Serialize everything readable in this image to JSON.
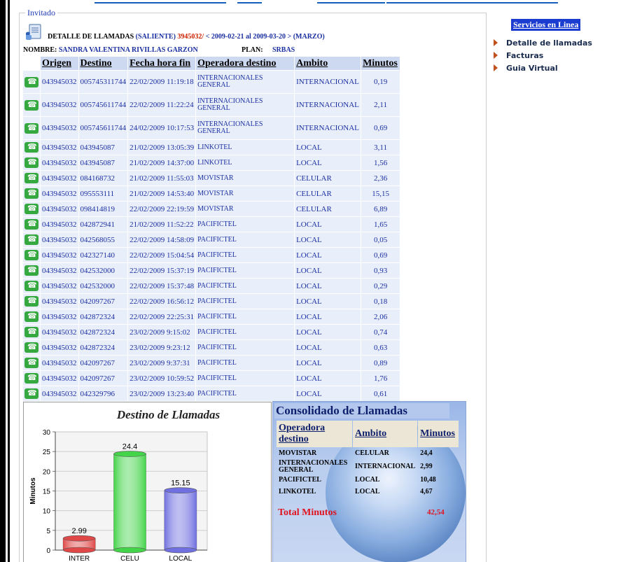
{
  "fieldset_legend": "Invitado",
  "header": {
    "title_label": "DETALLE DE LLAMADAS",
    "direction": "(SALIENTE)",
    "number": "3945032/",
    "period": "< 2009-02-21 al 2009-03-20 > (MARZO)",
    "name_label": "NOMBRE:",
    "name_value": "SANDRA VALENTINA RIVILLAS GARZON",
    "plan_label": "PLAN:",
    "plan_value": "SRBAS"
  },
  "table": {
    "headers": [
      "Origen",
      "Destino",
      "Fecha hora fin",
      "Operadora destino",
      "Ambito",
      "Minutos"
    ],
    "rows": [
      {
        "origen": "043945032",
        "destino": "005745311744",
        "fecha": "22/02/2009 11:19:18",
        "operadora": "INTERNACIONALES GENERAL",
        "ambito": "INTERNACIONAL",
        "minutos": "0,19"
      },
      {
        "origen": "043945032",
        "destino": "005745611744",
        "fecha": "22/02/2009 11:22:24",
        "operadora": "INTERNACIONALES GENERAL",
        "ambito": "INTERNACIONAL",
        "minutos": "2,11"
      },
      {
        "origen": "043945032",
        "destino": "005745611744",
        "fecha": "24/02/2009 10:17:53",
        "operadora": "INTERNACIONALES GENERAL",
        "ambito": "INTERNACIONAL",
        "minutos": "0,69"
      },
      {
        "origen": "043945032",
        "destino": "043945087",
        "fecha": "21/02/2009 13:05:39",
        "operadora": "LINKOTEL",
        "ambito": "LOCAL",
        "minutos": "3,11"
      },
      {
        "origen": "043945032",
        "destino": "043945087",
        "fecha": "21/02/2009 14:37:00",
        "operadora": "LINKOTEL",
        "ambito": "LOCAL",
        "minutos": "1,56"
      },
      {
        "origen": "043945032",
        "destino": "084168732",
        "fecha": "21/02/2009 11:55:03",
        "operadora": "MOVISTAR",
        "ambito": "CELULAR",
        "minutos": "2,36"
      },
      {
        "origen": "043945032",
        "destino": "095553111",
        "fecha": "21/02/2009 14:53:40",
        "operadora": "MOVISTAR",
        "ambito": "CELULAR",
        "minutos": "15,15"
      },
      {
        "origen": "043945032",
        "destino": "098414819",
        "fecha": "22/02/2009 22:19:59",
        "operadora": "MOVISTAR",
        "ambito": "CELULAR",
        "minutos": "6,89"
      },
      {
        "origen": "043945032",
        "destino": "042872941",
        "fecha": "21/02/2009 11:52:22",
        "operadora": "PACIFICTEL",
        "ambito": "LOCAL",
        "minutos": "1,65"
      },
      {
        "origen": "043945032",
        "destino": "042568055",
        "fecha": "22/02/2009 14:58:09",
        "operadora": "PACIFICTEL",
        "ambito": "LOCAL",
        "minutos": "0,05"
      },
      {
        "origen": "043945032",
        "destino": "042327140",
        "fecha": "22/02/2009 15:04:54",
        "operadora": "PACIFICTEL",
        "ambito": "LOCAL",
        "minutos": "0,69"
      },
      {
        "origen": "043945032",
        "destino": "042532000",
        "fecha": "22/02/2009 15:37:19",
        "operadora": "PACIFICTEL",
        "ambito": "LOCAL",
        "minutos": "0,93"
      },
      {
        "origen": "043945032",
        "destino": "042532000",
        "fecha": "22/02/2009 15:37:48",
        "operadora": "PACIFICTEL",
        "ambito": "LOCAL",
        "minutos": "0,29"
      },
      {
        "origen": "043945032",
        "destino": "042097267",
        "fecha": "22/02/2009 16:56:12",
        "operadora": "PACIFICTEL",
        "ambito": "LOCAL",
        "minutos": "0,18"
      },
      {
        "origen": "043945032",
        "destino": "042872324",
        "fecha": "22/02/2009 22:25:31",
        "operadora": "PACIFICTEL",
        "ambito": "LOCAL",
        "minutos": "2,06"
      },
      {
        "origen": "043945032",
        "destino": "042872324",
        "fecha": "23/02/2009 9:15:02",
        "operadora": "PACIFICTEL",
        "ambito": "LOCAL",
        "minutos": "0,74"
      },
      {
        "origen": "043945032",
        "destino": "042872324",
        "fecha": "23/02/2009 9:23:12",
        "operadora": "PACIFICTEL",
        "ambito": "LOCAL",
        "minutos": "0,63"
      },
      {
        "origen": "043945032",
        "destino": "042097267",
        "fecha": "23/02/2009 9:37:31",
        "operadora": "PACIFICTEL",
        "ambito": "LOCAL",
        "minutos": "0,89"
      },
      {
        "origen": "043945032",
        "destino": "042097267",
        "fecha": "23/02/2009 10:59:52",
        "operadora": "PACIFICTEL",
        "ambito": "LOCAL",
        "minutos": "1,76"
      },
      {
        "origen": "043945032",
        "destino": "042329796",
        "fecha": "23/02/2009 13:23:40",
        "operadora": "PACIFICTEL",
        "ambito": "LOCAL",
        "minutos": "0,61"
      }
    ]
  },
  "chart_data": {
    "type": "bar",
    "title": "Destino de Llamadas",
    "ylabel": "Minutos",
    "xlabel": "",
    "categories": [
      "INTER",
      "CELU",
      "LOCAL"
    ],
    "values": [
      2.99,
      24.4,
      15.15
    ],
    "value_labels": [
      "2.99",
      "24.4",
      "15.15"
    ],
    "colors": [
      "#e04848",
      "#44d44a",
      "#7070e0"
    ],
    "ylim": [
      0,
      30
    ],
    "yticks": [
      "0",
      "5",
      "10",
      "15",
      "20",
      "25",
      "30"
    ],
    "grid": true
  },
  "consolidado": {
    "title": "Consolidado de Llamadas",
    "headers": [
      "Operadora destino",
      "Ambito",
      "Minutos"
    ],
    "rows": [
      {
        "operadora": "MOVISTAR",
        "ambito": "CELULAR",
        "minutos": "24,4"
      },
      {
        "operadora": "INTERNACIONALES GENERAL",
        "ambito": "INTERNACIONAL",
        "minutos": "2,99"
      },
      {
        "operadora": "PACIFICTEL",
        "ambito": "LOCAL",
        "minutos": "10,48"
      },
      {
        "operadora": "LINKOTEL",
        "ambito": "LOCAL",
        "minutos": "4,67"
      }
    ],
    "total_label": "Total Minutos",
    "total_value": "42,54"
  },
  "sidebar": {
    "title": "Servicios en Linea",
    "items": [
      "Detalle de llamadas",
      "Facturas",
      "Guia Virtual"
    ]
  }
}
